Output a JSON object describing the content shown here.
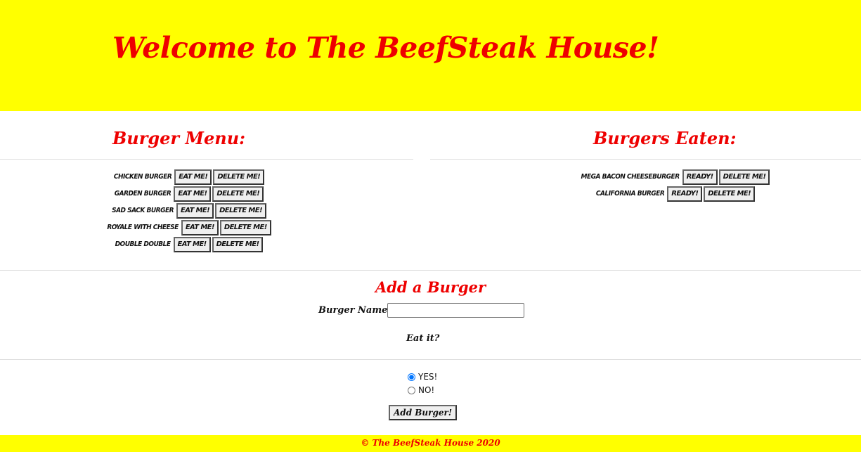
{
  "header": {
    "title": "Welcome to The BeefSteak House!"
  },
  "menu": {
    "title": "Burger Menu:",
    "eat_label": "Eat Me!",
    "delete_label": "Delete Me!",
    "items": [
      {
        "name": "Chicken Burger"
      },
      {
        "name": "Garden Burger"
      },
      {
        "name": "Sad Sack Burger"
      },
      {
        "name": "Royale with Cheese"
      },
      {
        "name": "Double Double"
      }
    ]
  },
  "eaten": {
    "title": "Burgers Eaten:",
    "ready_label": "Ready!",
    "delete_label": "Delete Me!",
    "items": [
      {
        "name": "Mega Bacon Cheeseburger"
      },
      {
        "name": "California Burger"
      }
    ]
  },
  "form": {
    "title": "Add a Burger",
    "name_label": "Burger Name:",
    "name_value": "",
    "eat_question": "Eat it?",
    "options": [
      {
        "label": "YES!",
        "checked": true
      },
      {
        "label": "NO!",
        "checked": false
      }
    ],
    "submit_label": "Add Burger!"
  },
  "footer": {
    "text": "© The BeefSteak House 2020"
  },
  "colors": {
    "accent_yellow": "#ffff00",
    "title_red": "#ee0000"
  }
}
